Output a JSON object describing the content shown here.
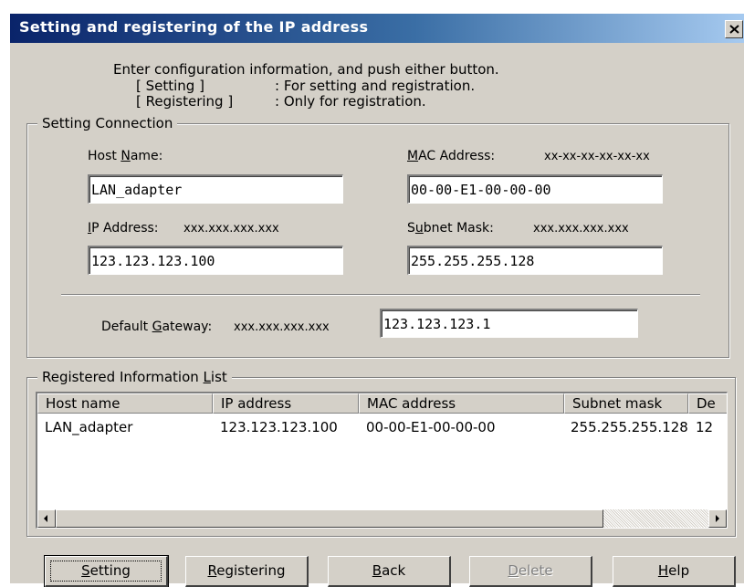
{
  "window": {
    "title": "Setting and registering of the IP address",
    "close_symbol": "×"
  },
  "intro": {
    "line1": "Enter configuration information, and push either button.",
    "setting_key": "[ Setting ]",
    "setting_desc": ": For setting and registration.",
    "registering_key": "[ Registering ]",
    "registering_desc": ": Only for registration."
  },
  "setting_connection": {
    "legend": "Setting Connection",
    "host_name_label_pre": "Host ",
    "host_name_label_u": "N",
    "host_name_label_post": "ame:",
    "host_name_value": "LAN_adapter",
    "mac_label_u": "M",
    "mac_label_post": "AC Address:",
    "mac_hint": "xx-xx-xx-xx-xx-xx",
    "mac_value": "00-00-E1-00-00-00",
    "ip_label_u": "I",
    "ip_label_post": "P Address:",
    "ip_hint": "xxx.xxx.xxx.xxx",
    "ip_value": "123.123.123.100",
    "subnet_label_pre": "S",
    "subnet_label_u": "u",
    "subnet_label_post": "bnet Mask:",
    "subnet_hint": "xxx.xxx.xxx.xxx",
    "subnet_value": "255.255.255.128",
    "gateway_label_pre": "Default ",
    "gateway_label_u": "G",
    "gateway_label_post": "ateway:",
    "gateway_hint": "xxx.xxx.xxx.xxx",
    "gateway_value": "123.123.123.1"
  },
  "registered_list": {
    "legend_pre": "Registered Information ",
    "legend_u": "L",
    "legend_post": "ist",
    "columns": [
      "Host name",
      "IP address",
      "MAC address",
      "Subnet mask",
      "De"
    ],
    "rows": [
      [
        "LAN_adapter",
        "123.123.123.100",
        "00-00-E1-00-00-00",
        "255.255.255.128",
        "12"
      ]
    ]
  },
  "buttons": {
    "setting_u": "S",
    "setting_rest": "etting",
    "registering_u": "R",
    "registering_rest": "egistering",
    "back_u": "B",
    "back_rest": "ack",
    "delete_u": "D",
    "delete_rest": "elete",
    "help_u": "H",
    "help_rest": "elp"
  }
}
